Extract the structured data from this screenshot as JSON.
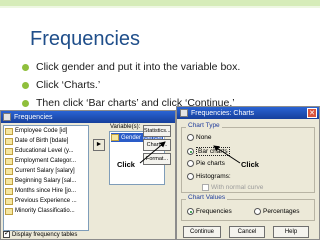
{
  "slide": {
    "title": "Frequencies",
    "bullets": [
      "Click gender and put it into the variable box.",
      "Click ‘Charts.’",
      "Then click ‘Bar charts’ and click ‘Continue.’"
    ],
    "bullet_color": "#8fbf3c",
    "title_color": "#1f4e8a"
  },
  "frequencies_dialog": {
    "title": "Frequencies",
    "variable_list": [
      "Employee Code [id]",
      "Date of Birth [bdate]",
      "Educational Level (y...",
      "Employment Categor...",
      "Current Salary [salary]",
      "Beginning Salary [sal...",
      "Months since Hire [jo...",
      "Previous Experience ...",
      "Minority Classificatio..."
    ],
    "selected_label": "Variable(s):",
    "selected_variables": [
      "Gender [gender]"
    ],
    "buttons": {
      "statistics": "Statistics...",
      "charts": "Charts...",
      "format": "Format..."
    },
    "display_tables_label": "Display frequency tables",
    "display_tables_checked": true
  },
  "charts_dialog": {
    "title": "Frequencies: Charts",
    "chart_type_group": "Chart Type",
    "chart_type_options": [
      "None",
      "Bar charts",
      "Pie charts",
      "Histograms:"
    ],
    "normal_curve_label": "With normal curve",
    "selected_chart_type": "Bar charts",
    "chart_values_group": "Chart Values",
    "value_options": [
      "Frequencies",
      "Percentages"
    ],
    "selected_value": "Frequencies",
    "buttons": {
      "continue": "Continue",
      "cancel": "Cancel",
      "help": "Help"
    }
  },
  "annotations": {
    "click_left": "Click",
    "click_right": "Click"
  }
}
